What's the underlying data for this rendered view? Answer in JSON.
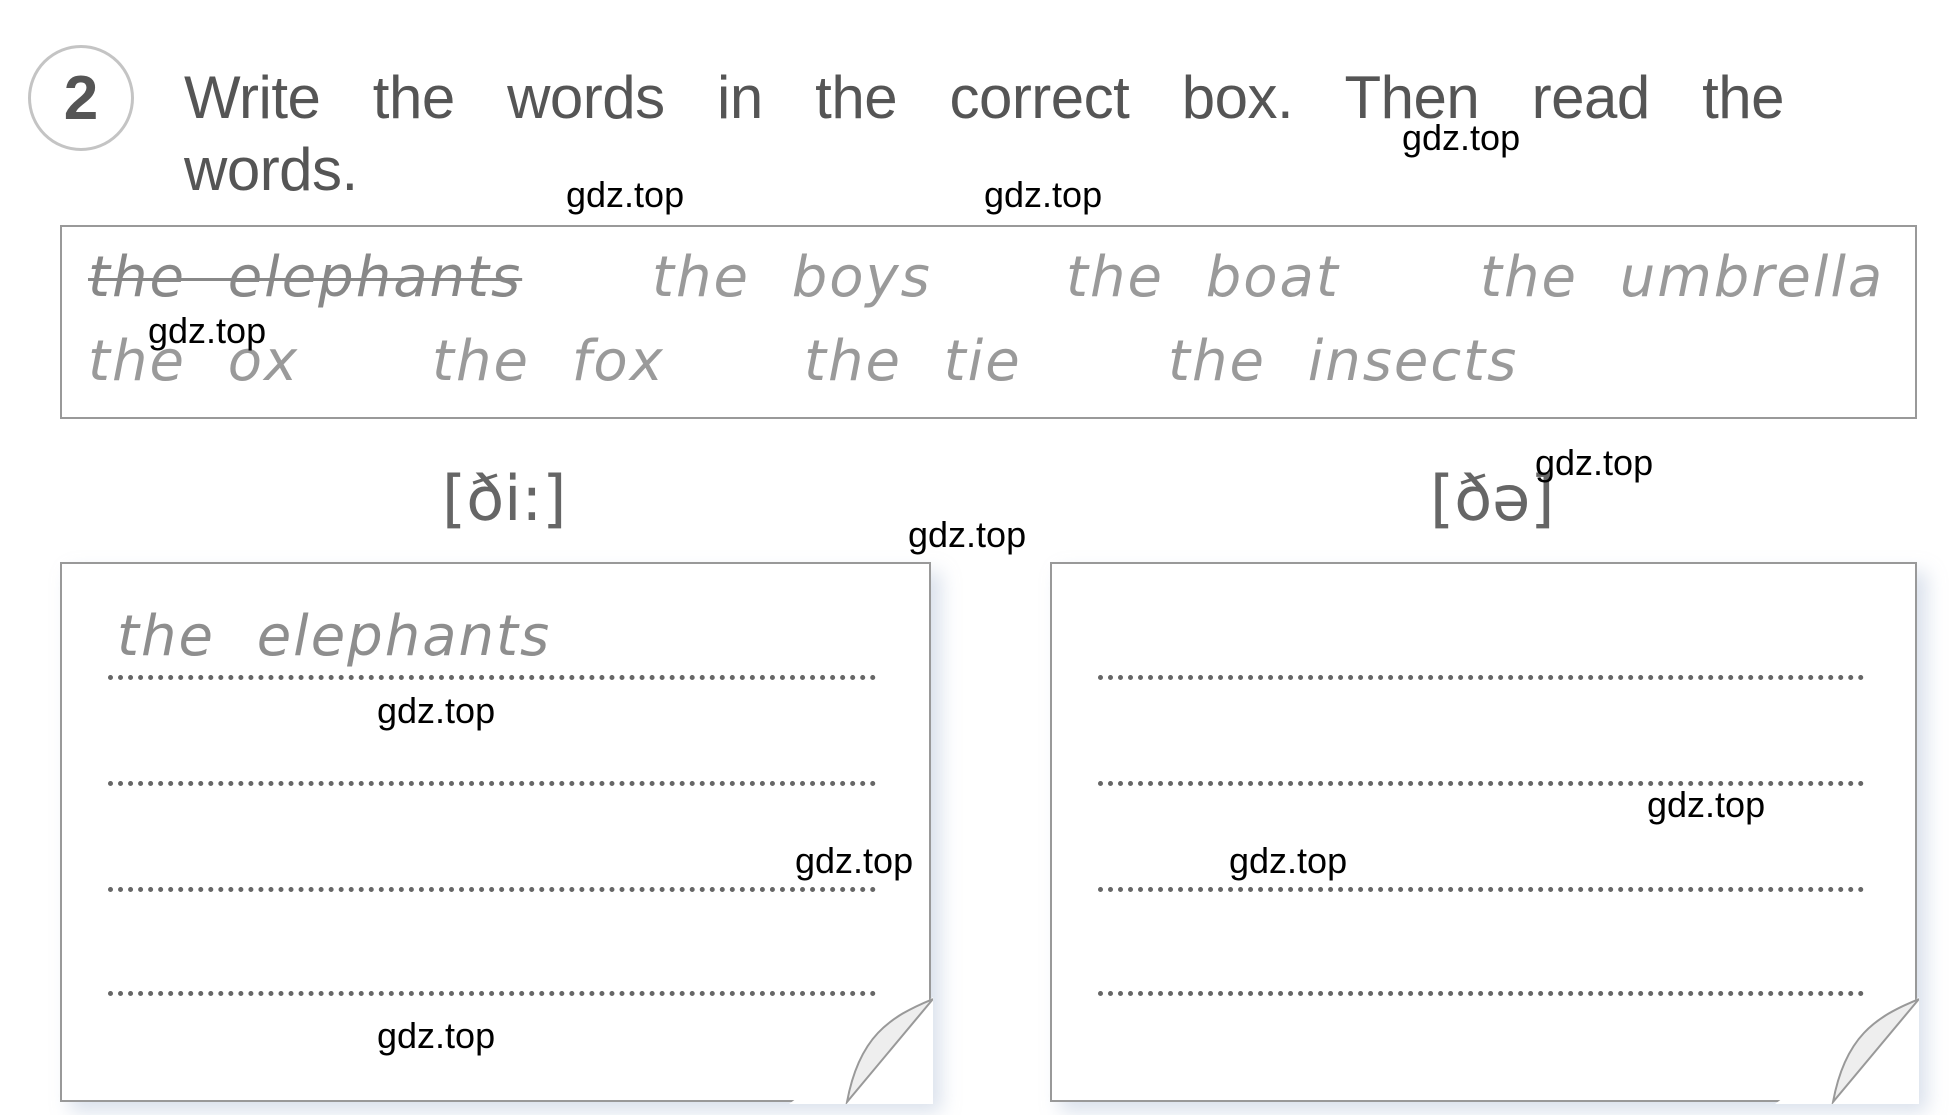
{
  "exercise": {
    "number": "2",
    "instruction": "Write the words in the correct box. Then read the words."
  },
  "word_bank": {
    "words": [
      "the elephants",
      "the boys",
      "the boat",
      "the umbrella",
      "the ox",
      "the fox",
      "the tie",
      "the insects"
    ],
    "crossed_out": "the elephants"
  },
  "boxes": [
    {
      "label": "[ði:]",
      "entries": [
        "the elephants",
        "",
        "",
        ""
      ]
    },
    {
      "label": "[ðə]",
      "entries": [
        "",
        "",
        "",
        ""
      ]
    }
  ],
  "watermark": "gdz.top"
}
